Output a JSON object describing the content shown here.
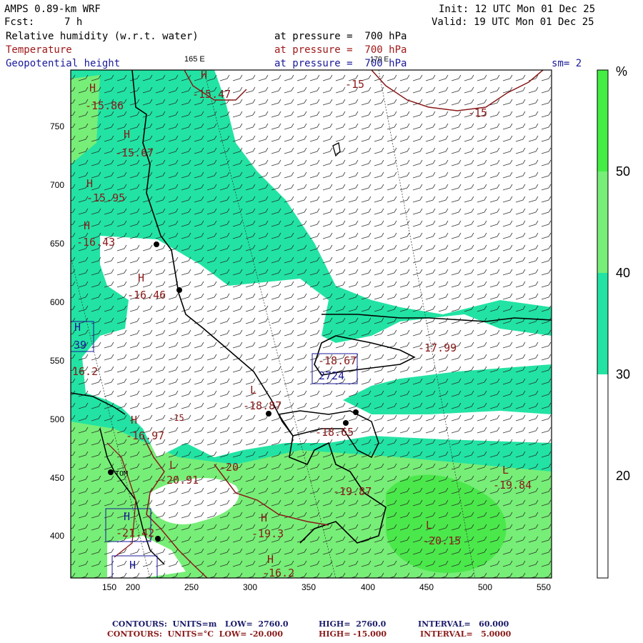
{
  "header": {
    "model": "AMPS 0.89-km WRF",
    "fcst_label": "Fcst:",
    "fcst_value": "7 h",
    "init": "Init: 12 UTC Mon 01 Dec 25",
    "valid": "Valid: 19 UTC Mon 01 Dec 25",
    "fields": [
      {
        "name": "Relative humidity (w.r.t. water)",
        "level": "at pressure =  700 hPa"
      },
      {
        "name": "Temperature",
        "level": "at pressure =  700 hPa"
      },
      {
        "name": "Geopotential height",
        "level": "at pressure =  700 hPa"
      }
    ],
    "smoothing": "sm= 2",
    "lon_label_1": "165 E",
    "lon_label_2": "170 E"
  },
  "axes": {
    "x_ticks": [
      "150",
      "200",
      "250",
      "300",
      "350",
      "400",
      "450",
      "500",
      "550"
    ],
    "y_ticks": [
      "750",
      "700",
      "650",
      "600",
      "550",
      "500",
      "450",
      "400"
    ]
  },
  "colorbar": {
    "unit": "%",
    "labels": [
      "50",
      "40",
      "30",
      "20"
    ],
    "colors": {
      "gt50": "#44ee44",
      "40_50": "#77ee77",
      "30_40": "#22e3a3",
      "lt30": "#ffffff"
    }
  },
  "map_labels": [
    {
      "text": "-15.86",
      "c": "red"
    },
    {
      "text": "-15.47",
      "c": "red"
    },
    {
      "text": "-15",
      "c": "red"
    },
    {
      "text": "-15",
      "c": "red"
    },
    {
      "text": "-15.67",
      "c": "red"
    },
    {
      "text": "-15.95",
      "c": "red"
    },
    {
      "text": "-16.43",
      "c": "red"
    },
    {
      "text": "-16.46",
      "c": "red"
    },
    {
      "text": "-18.67",
      "c": "red"
    },
    {
      "text": "2724",
      "c": "blue"
    },
    {
      "text": "-17.99",
      "c": "red"
    },
    {
      "text": "-18.87",
      "c": "red"
    },
    {
      "text": "-18.65",
      "c": "red"
    },
    {
      "text": "-16.97",
      "c": "red"
    },
    {
      "text": "-20.91",
      "c": "red"
    },
    {
      "text": "-20",
      "c": "red"
    },
    {
      "text": "-19.87",
      "c": "red"
    },
    {
      "text": "-19.84",
      "c": "red"
    },
    {
      "text": "-20.15",
      "c": "red"
    },
    {
      "text": "-19.3",
      "c": "red"
    },
    {
      "text": "-21.42",
      "c": "red"
    },
    {
      "text": "-16.2",
      "c": "red"
    },
    {
      "text": "39",
      "c": "blue"
    },
    {
      "text": "16.2",
      "c": "red"
    },
    {
      "text": "-15",
      "c": "red"
    },
    {
      "text": "TOM",
      "c": "black"
    }
  ],
  "extrema_marks": [
    "H",
    "H",
    "H",
    "H",
    "H",
    "H",
    "L",
    "L",
    "L",
    "L",
    "H",
    "H",
    "H",
    "H",
    "H",
    "H"
  ],
  "footer": {
    "line1_label": "CONTOURS:  UNITS=m   LOW=  2760.0",
    "line1_high": "HIGH=  2760.0",
    "line1_interval": "INTERVAL=   60.000",
    "line2_label": "CONTOURS:  UNITS=°C  LOW= -20.000",
    "line2_high": "HIGH= -15.000",
    "line2_interval": "INTERVAL=   5.0000"
  }
}
